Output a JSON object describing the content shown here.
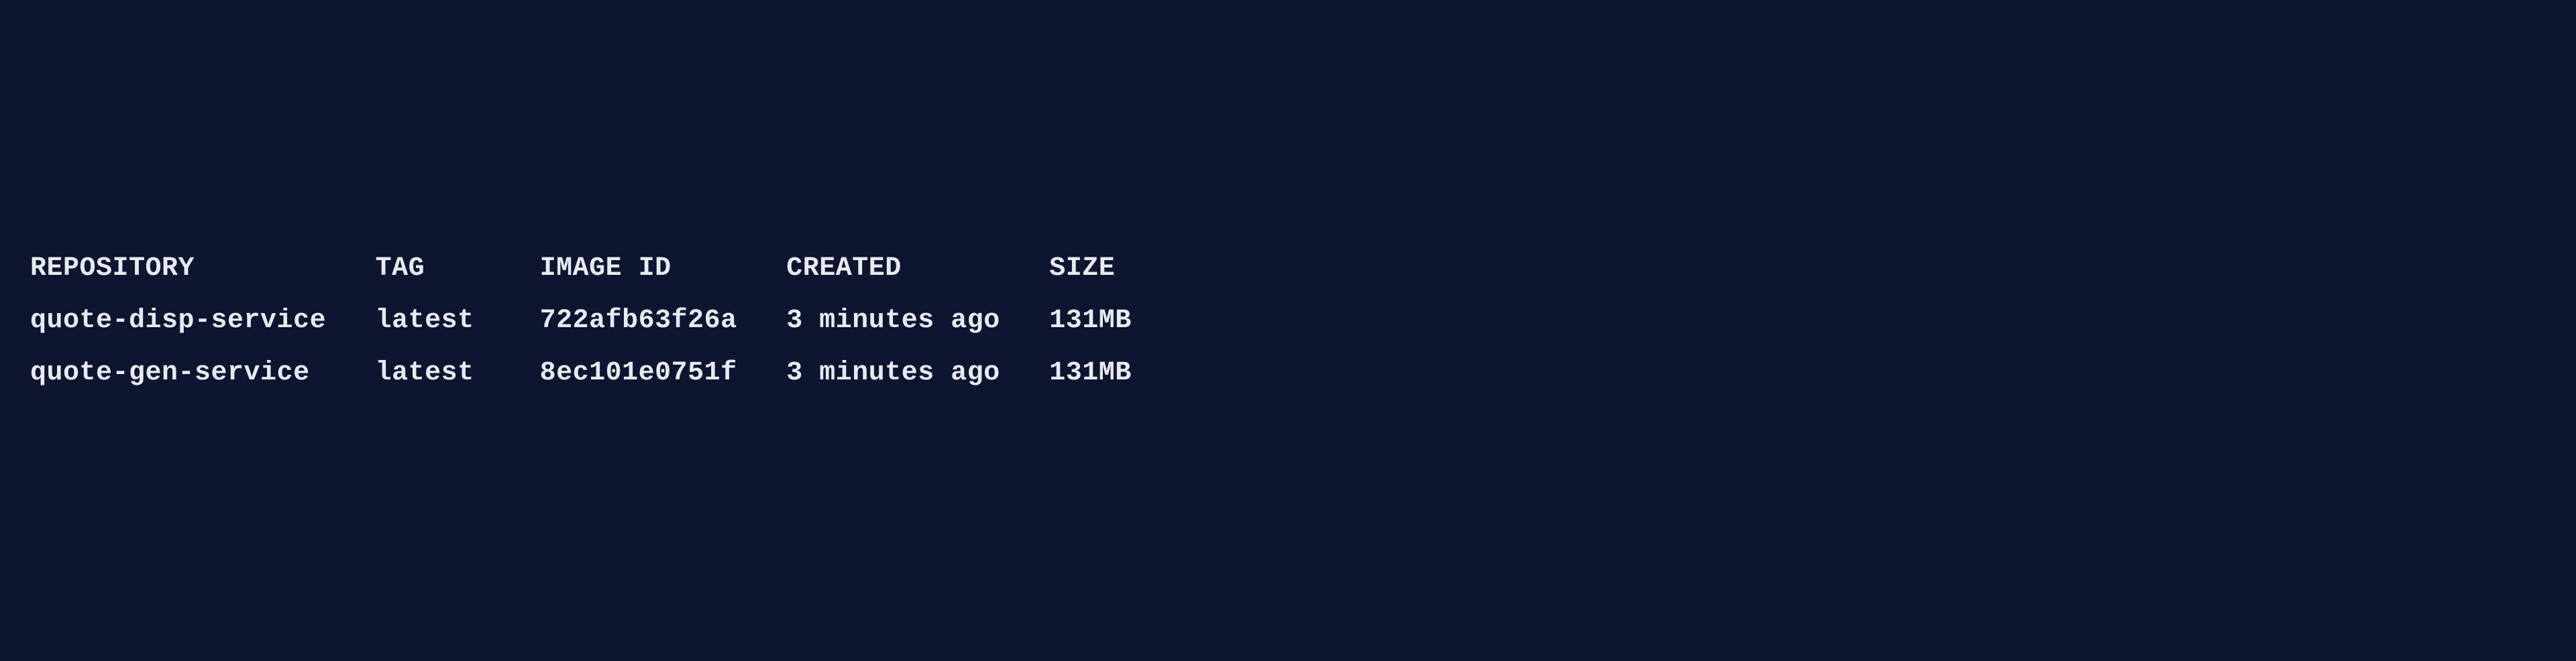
{
  "terminal": {
    "headers": {
      "repository": "REPOSITORY",
      "tag": "TAG",
      "image_id": "IMAGE ID",
      "created": "CREATED",
      "size": "SIZE"
    },
    "rows": [
      {
        "repository": "quote-disp-service",
        "tag": "latest",
        "image_id": "722afb63f26a",
        "created": "3 minutes ago",
        "size": "131MB"
      },
      {
        "repository": "quote-gen-service",
        "tag": "latest",
        "image_id": "8ec101e0751f",
        "created": "3 minutes ago",
        "size": "131MB"
      }
    ]
  }
}
